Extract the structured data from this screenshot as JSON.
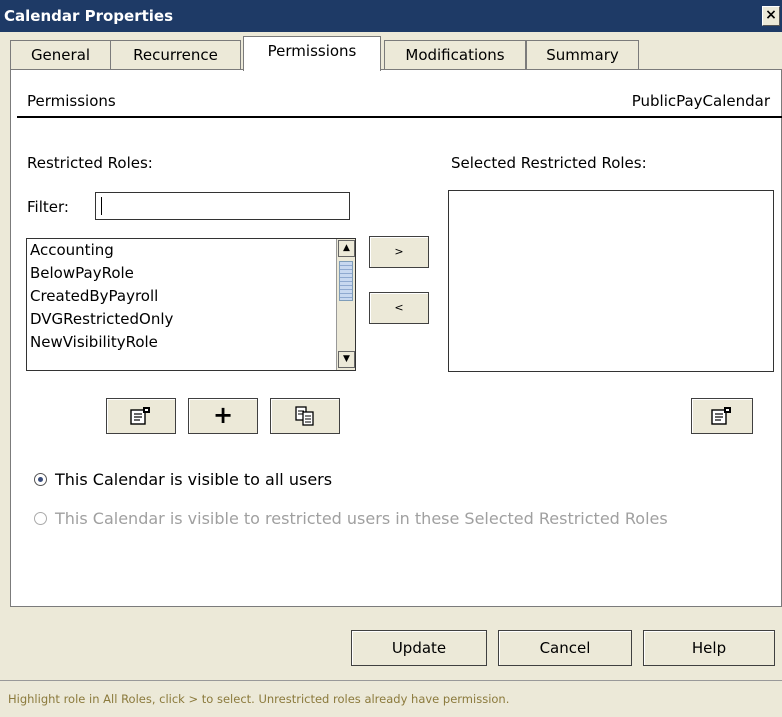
{
  "window": {
    "title": "Calendar Properties",
    "close_label": "×"
  },
  "tabs": [
    {
      "label": "General",
      "active": false
    },
    {
      "label": "Recurrence",
      "active": false
    },
    {
      "label": "Permissions",
      "active": true
    },
    {
      "label": "Modifications",
      "active": false
    },
    {
      "label": "Summary",
      "active": false
    }
  ],
  "header": {
    "section": "Permissions",
    "calendar_name": "PublicPayCalendar"
  },
  "restricted": {
    "label": "Restricted Roles:",
    "filter_label": "Filter:",
    "filter_value": "",
    "roles": [
      "Accounting",
      "BelowPayRole",
      "CreatedByPayroll",
      "DVGRestrictedOnly",
      "NewVisibilityRole"
    ]
  },
  "move": {
    "add_label": ">",
    "remove_label": "<"
  },
  "selected": {
    "label": "Selected Restricted Roles:",
    "roles": []
  },
  "visibility": {
    "all_users_label": "This Calendar is visible to all users",
    "restricted_label": "This Calendar is visible to restricted users in these Selected Restricted Roles",
    "selected": "all"
  },
  "role_buttons": {
    "add_label": "+"
  },
  "footer": {
    "update_label": "Update",
    "cancel_label": "Cancel",
    "help_label": "Help"
  },
  "status": {
    "message": "Highlight role in All Roles, click > to select. Unrestricted roles already have permission."
  },
  "icons": {
    "properties": "properties-icon",
    "add": "plus-icon",
    "copy": "copy-icon",
    "close": "close-icon"
  },
  "colors": {
    "title_bar": "#1e3a66",
    "disabled_text": "#a0a0a0",
    "status_text": "#8b7a3c"
  }
}
